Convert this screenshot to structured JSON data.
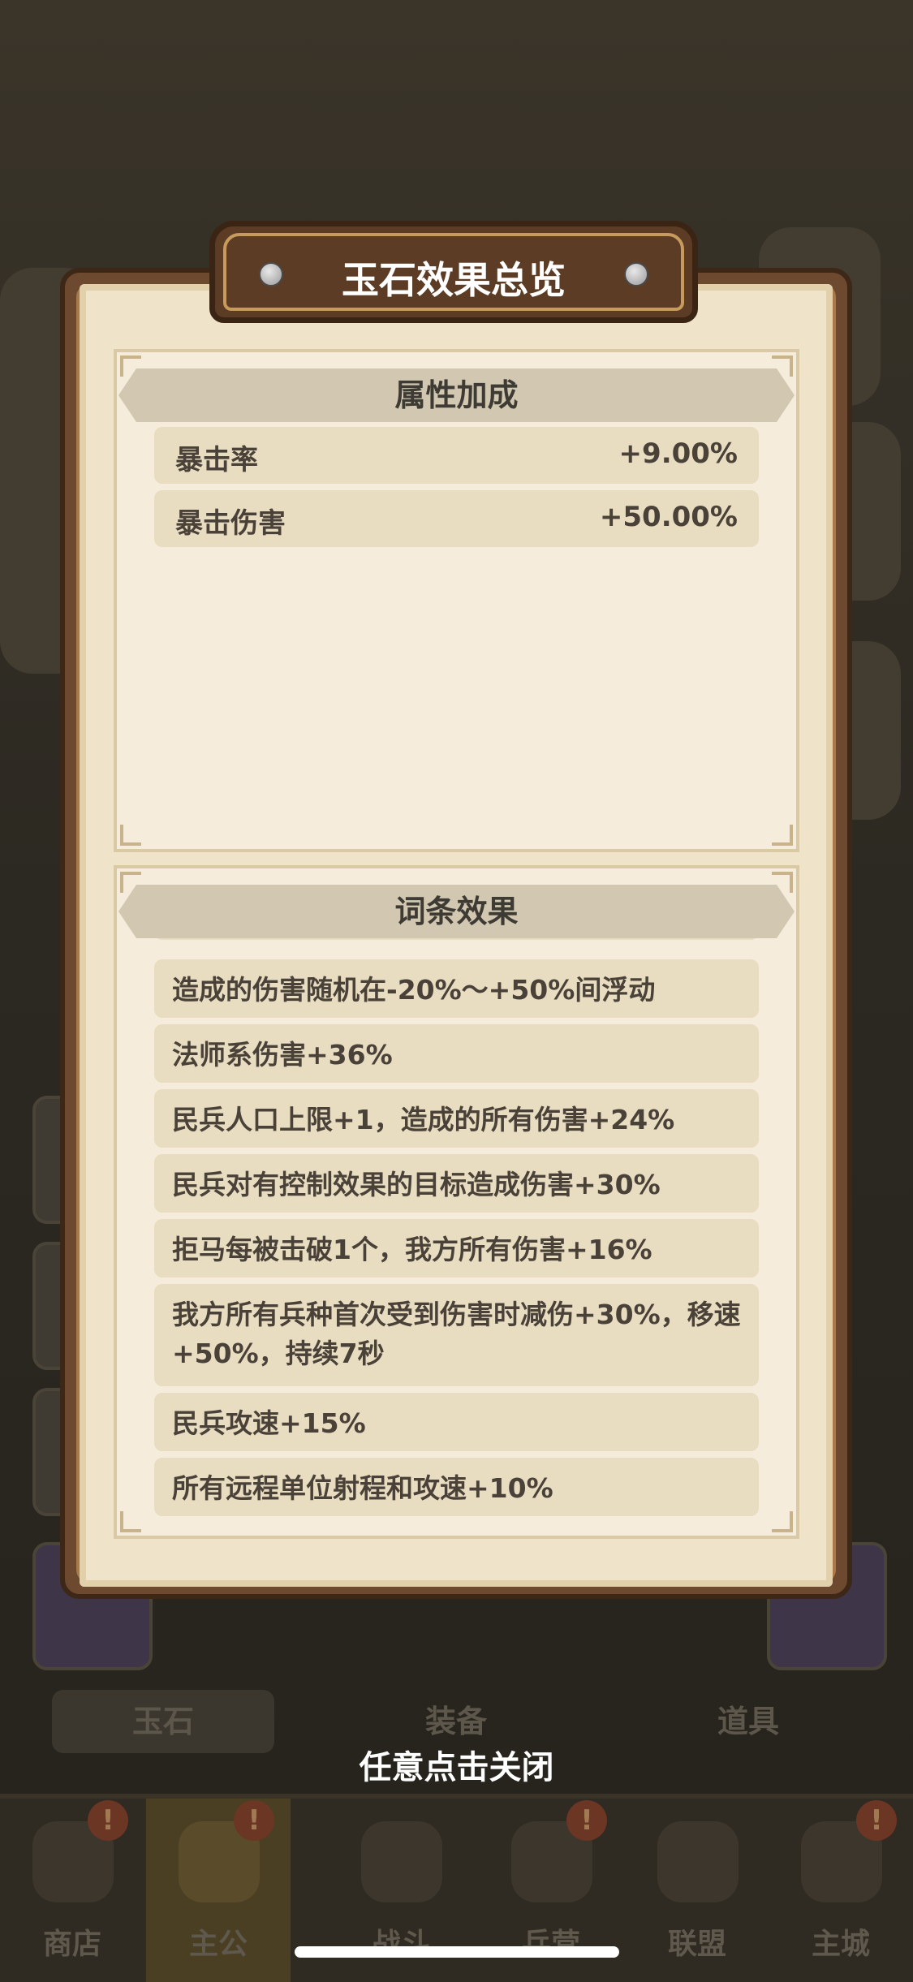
{
  "modal": {
    "title": "玉石效果总览",
    "close_hint": "任意点击关闭"
  },
  "attributes": {
    "header": "属性加成",
    "rows": [
      {
        "label": "暴击率",
        "value": "+9.00%"
      },
      {
        "label": "暴击伤害",
        "value": "+50.00%"
      }
    ]
  },
  "effects": {
    "header": "词条效果",
    "rows": [
      "造成的伤害随机在-20%～+50%间浮动",
      "法师系伤害+36%",
      "民兵人口上限+1，造成的所有伤害+24%",
      "民兵对有控制效果的目标造成伤害+30%",
      "拒马每被击破1个，我方所有伤害+16%",
      "我方所有兵种首次受到伤害时减伤+30%，移速+50%，持续7秒",
      "民兵攻速+15%",
      "所有远程单位射程和攻速+10%"
    ]
  },
  "background": {
    "bottom_tabs": [
      "玉石",
      "装备",
      "道具"
    ],
    "nav": [
      {
        "label": "商店",
        "badge": "!"
      },
      {
        "label": "主公",
        "badge": "!"
      },
      {
        "label": "战斗",
        "badge": ""
      },
      {
        "label": "兵营",
        "badge": "!"
      },
      {
        "label": "联盟",
        "badge": ""
      },
      {
        "label": "主城",
        "badge": "!"
      }
    ]
  }
}
